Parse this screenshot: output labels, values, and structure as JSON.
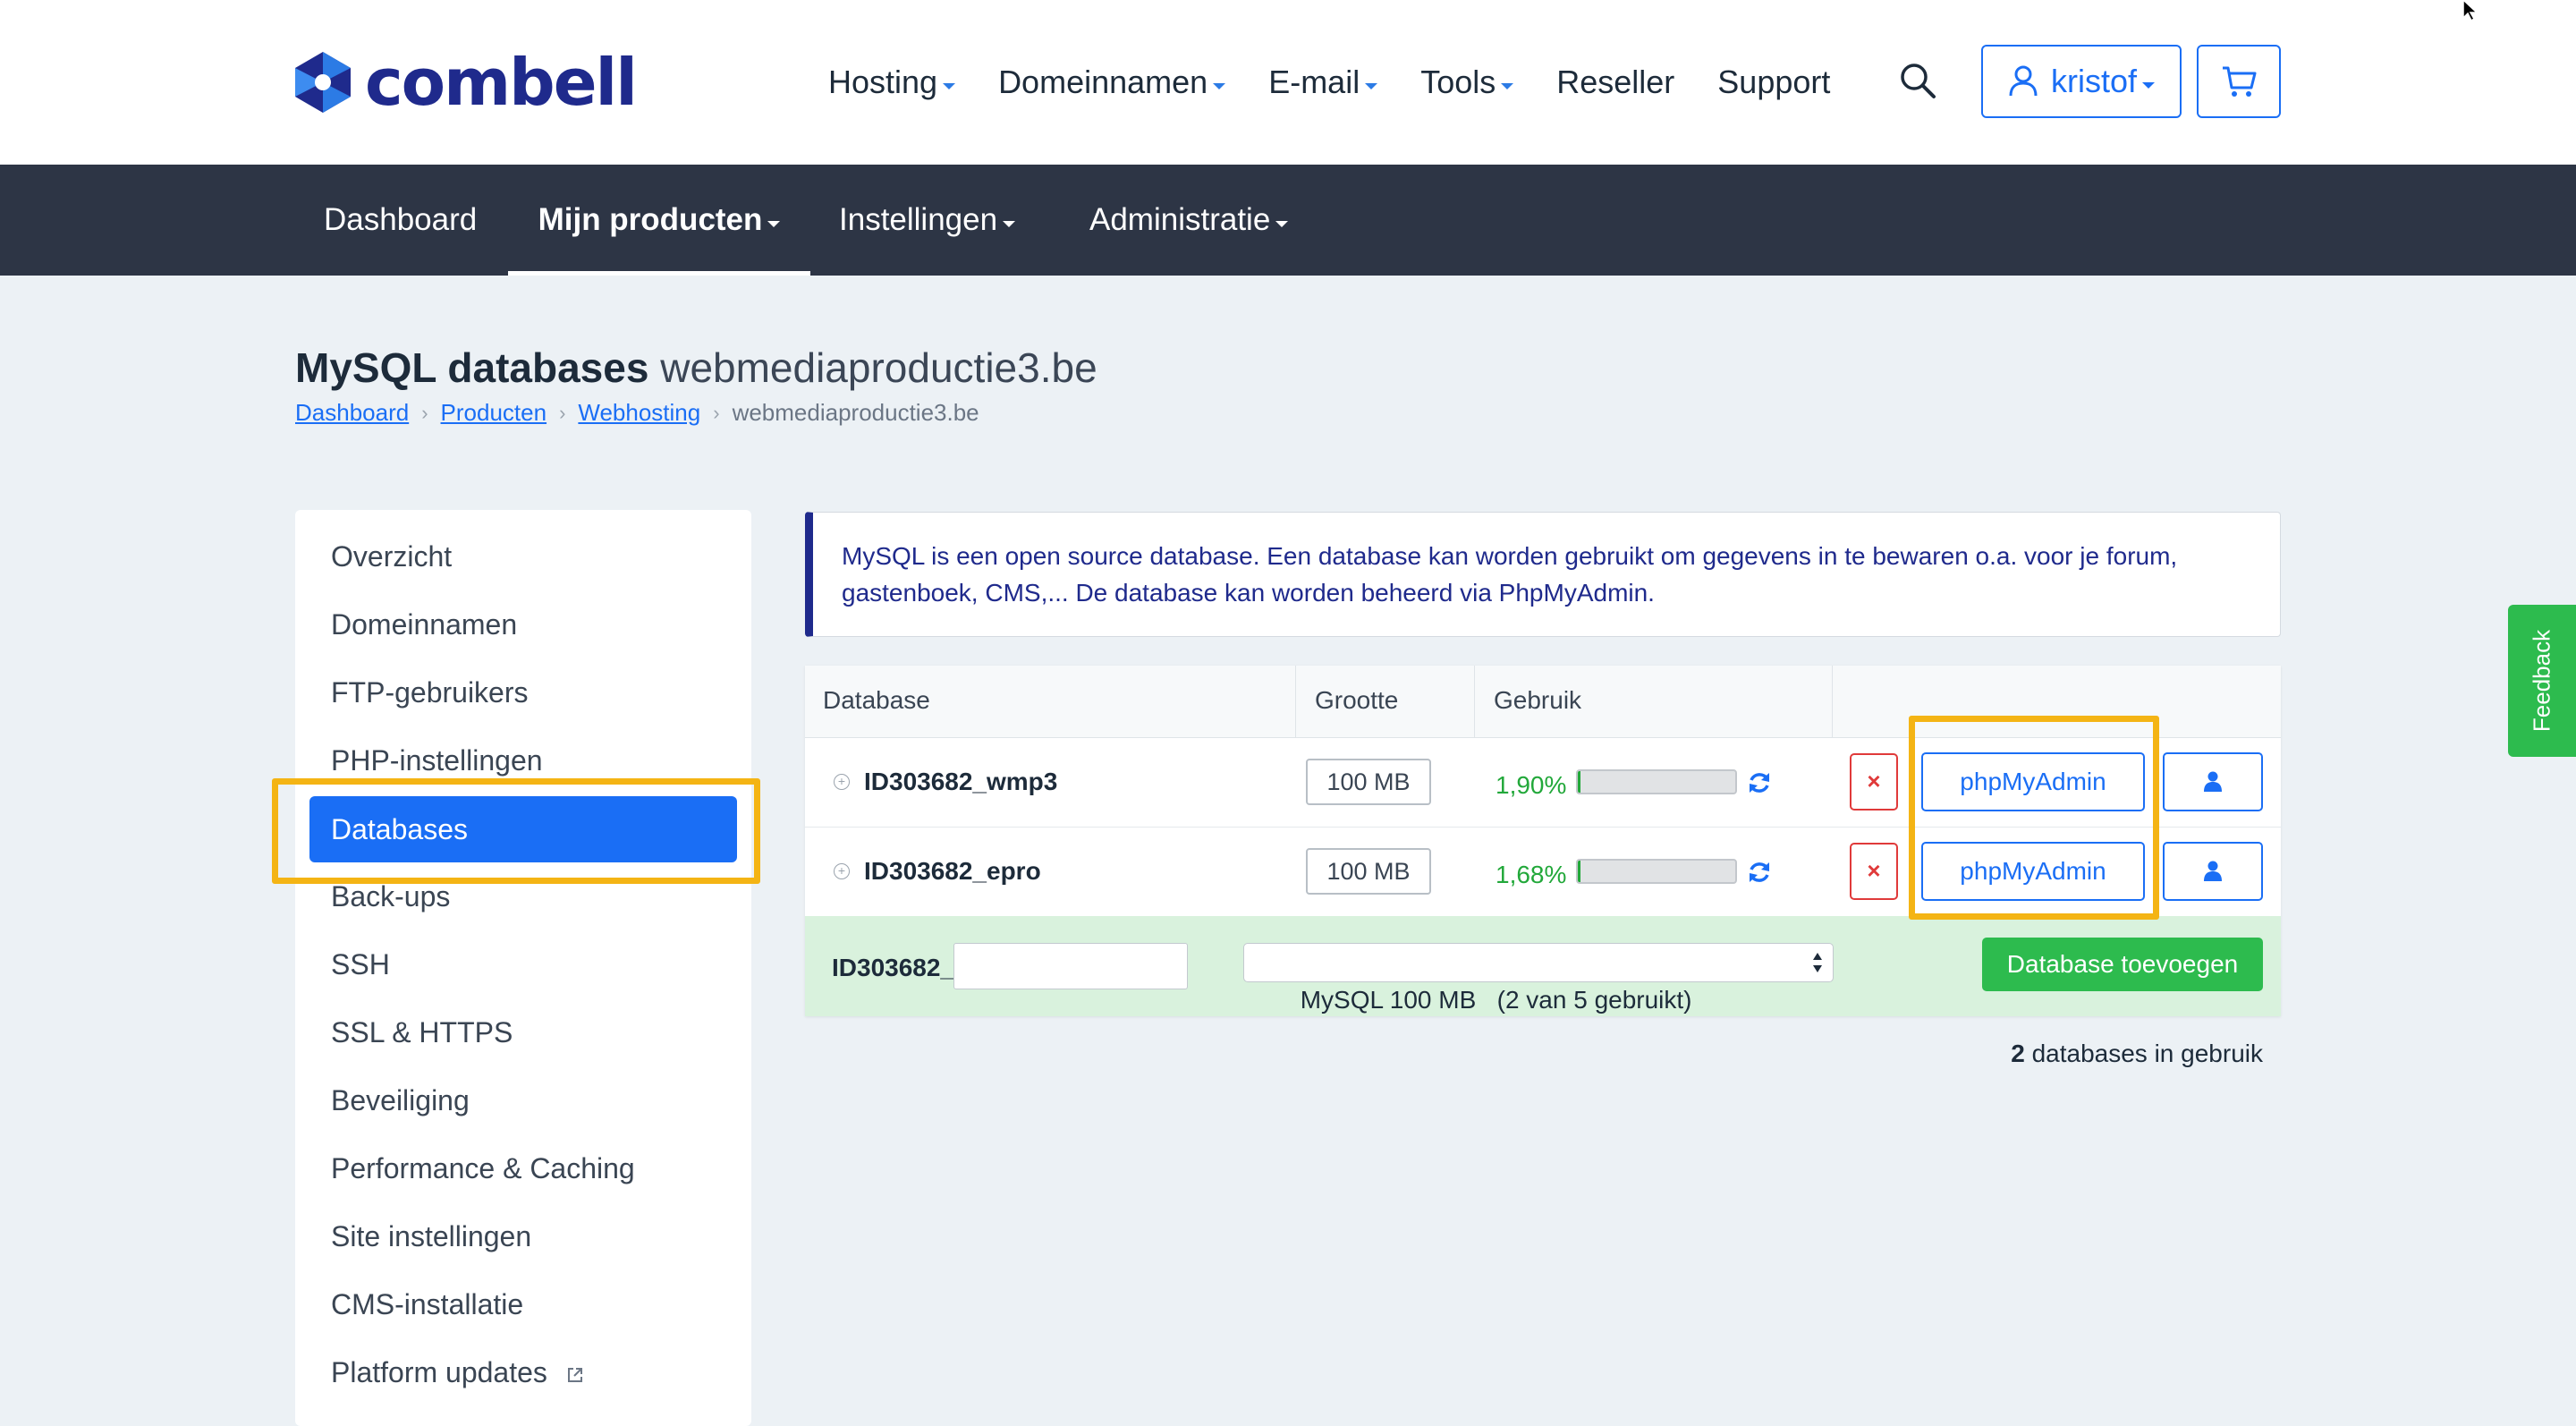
{
  "brand": {
    "name": "combell"
  },
  "main_nav": {
    "items": [
      {
        "label": "Hosting",
        "dropdown": true
      },
      {
        "label": "Domeinnamen",
        "dropdown": true
      },
      {
        "label": "E-mail",
        "dropdown": true
      },
      {
        "label": "Tools",
        "dropdown": true
      },
      {
        "label": "Reseller",
        "dropdown": false
      },
      {
        "label": "Support",
        "dropdown": false
      }
    ],
    "search_icon": "search-icon",
    "user_label": "kristof",
    "cart_icon": "cart-icon"
  },
  "sub_nav": {
    "items": [
      {
        "label": "Dashboard"
      },
      {
        "label": "Mijn producten",
        "active": true
      },
      {
        "label": "Instellingen"
      },
      {
        "label": "Administratie"
      }
    ]
  },
  "page": {
    "title_bold": "MySQL databases",
    "title_domain": "webmediaproductie3.be",
    "breadcrumb": [
      "Dashboard",
      "Producten",
      "Webhosting",
      "webmediaproductie3.be"
    ]
  },
  "sidebar": {
    "items": [
      {
        "label": "Overzicht"
      },
      {
        "label": "Domeinnamen"
      },
      {
        "label": "FTP-gebruikers"
      },
      {
        "label": "PHP-instellingen"
      },
      {
        "label": "Databases",
        "active": true
      },
      {
        "label": "Back-ups"
      },
      {
        "label": "SSH"
      },
      {
        "label": "SSL & HTTPS"
      },
      {
        "label": "Beveiliging"
      },
      {
        "label": "Performance & Caching"
      },
      {
        "label": "Site instellingen"
      },
      {
        "label": "CMS-installatie"
      },
      {
        "label": "Platform updates",
        "external": true
      }
    ]
  },
  "info": {
    "text": "MySQL is een open source database. Een database kan worden gebruikt om gegevens in te bewaren o.a. voor je forum, gastenboek, CMS,... De database kan worden beheerd via PhpMyAdmin."
  },
  "table": {
    "headers": [
      "Database",
      "Grootte",
      "Gebruik"
    ],
    "rows": [
      {
        "name": "ID303682_wmp3",
        "size": "100 MB",
        "usage": "1,90%",
        "usage_fraction": 0.019,
        "admin_label": "phpMyAdmin"
      },
      {
        "name": "ID303682_epro",
        "size": "100 MB",
        "usage": "1,68%",
        "usage_fraction": 0.0168,
        "admin_label": "phpMyAdmin"
      }
    ],
    "delete_glyph": "×",
    "add_row": {
      "prefix": "ID303682_",
      "input_value": "",
      "select_value": "MySQL 100 MB   (2 van 5 gebruikt)",
      "button_label": "Database toevoegen"
    }
  },
  "summary": {
    "count": "2",
    "text": "databases in gebruik"
  },
  "feedback_label": "Feedback",
  "colors": {
    "brand_navy": "#1f2a8c",
    "accent_blue": "#1a6ef5",
    "success_green": "#2dbb4e",
    "danger_red": "#e03a3a",
    "highlight_yellow": "#f4b414",
    "subnav_dark": "#2d3545",
    "page_bg": "#ecf1f5"
  }
}
